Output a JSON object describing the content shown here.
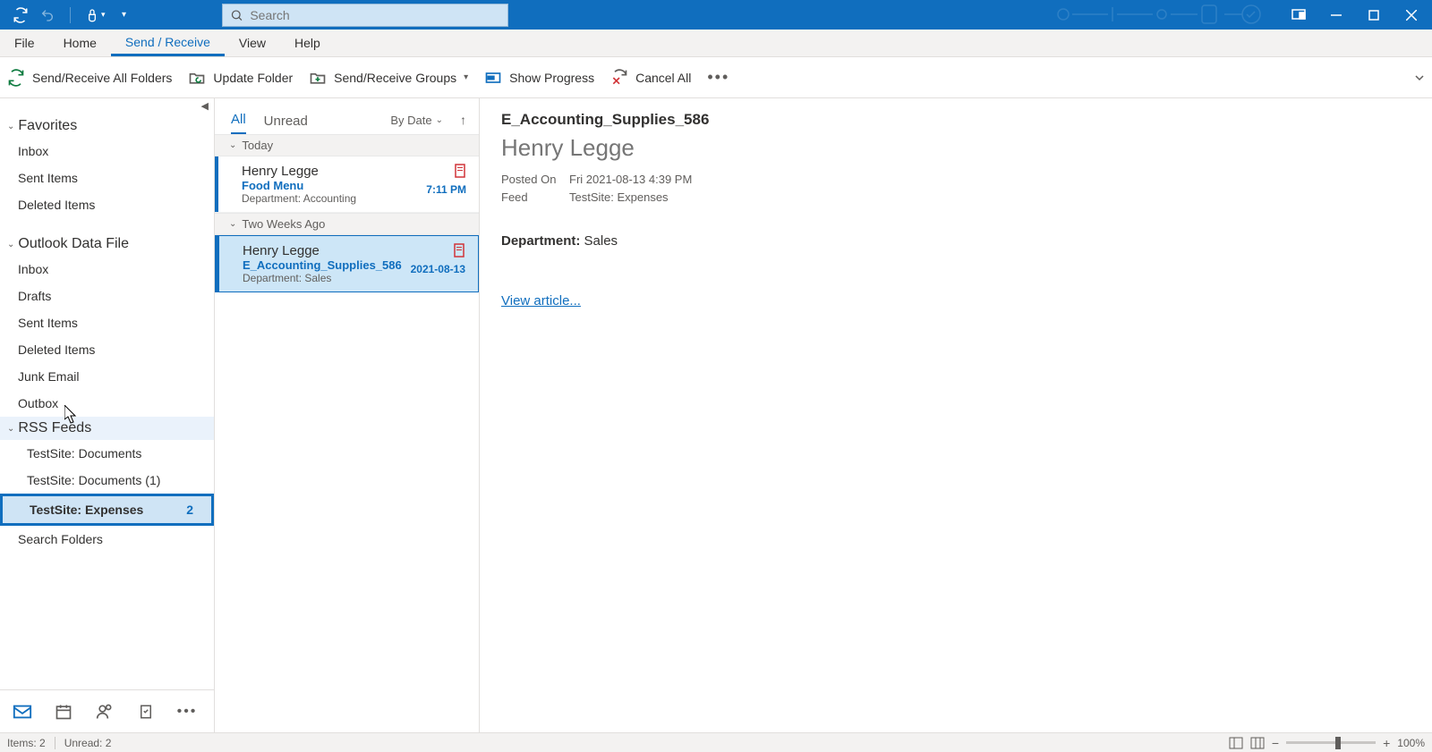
{
  "search": {
    "placeholder": "Search"
  },
  "menu": {
    "file": "File",
    "home": "Home",
    "sendreceive": "Send / Receive",
    "view": "View",
    "help": "Help"
  },
  "ribbon": {
    "sendall": "Send/Receive All Folders",
    "update": "Update Folder",
    "groups": "Send/Receive Groups",
    "progress": "Show Progress",
    "cancel": "Cancel All"
  },
  "sidebar": {
    "favorites": {
      "label": "Favorites",
      "inbox": "Inbox",
      "sent": "Sent Items",
      "deleted": "Deleted Items"
    },
    "datafile": {
      "label": "Outlook Data File",
      "inbox": "Inbox",
      "drafts": "Drafts",
      "sent": "Sent Items",
      "deleted": "Deleted Items",
      "junk": "Junk Email",
      "outbox": "Outbox"
    },
    "rss": {
      "label": "RSS Feeds",
      "docs": "TestSite: Documents",
      "docs1": "TestSite: Documents (1)",
      "expenses": "TestSite: Expenses",
      "expenses_count": "2"
    },
    "search": "Search Folders"
  },
  "msglist": {
    "tab_all": "All",
    "tab_unread": "Unread",
    "sort": "By Date",
    "groups": {
      "today": "Today",
      "twoweeks": "Two Weeks Ago"
    },
    "items": [
      {
        "from": "Henry Legge",
        "subject": "Food Menu",
        "time": "7:11 PM",
        "preview": "Department: Accounting"
      },
      {
        "from": "Henry Legge",
        "subject": "E_Accounting_Supplies_586",
        "time": "2021-08-13",
        "preview": "Department: Sales"
      }
    ]
  },
  "reading": {
    "subject": "E_Accounting_Supplies_586",
    "from": "Henry Legge",
    "posted_label": "Posted On",
    "posted_value": "Fri 2021-08-13 4:39 PM",
    "feed_label": "Feed",
    "feed_value": "TestSite: Expenses",
    "body_label": "Department:",
    "body_value": "Sales",
    "link": "View article..."
  },
  "status": {
    "items": "Items: 2",
    "unread": "Unread: 2",
    "zoom": "100%"
  }
}
